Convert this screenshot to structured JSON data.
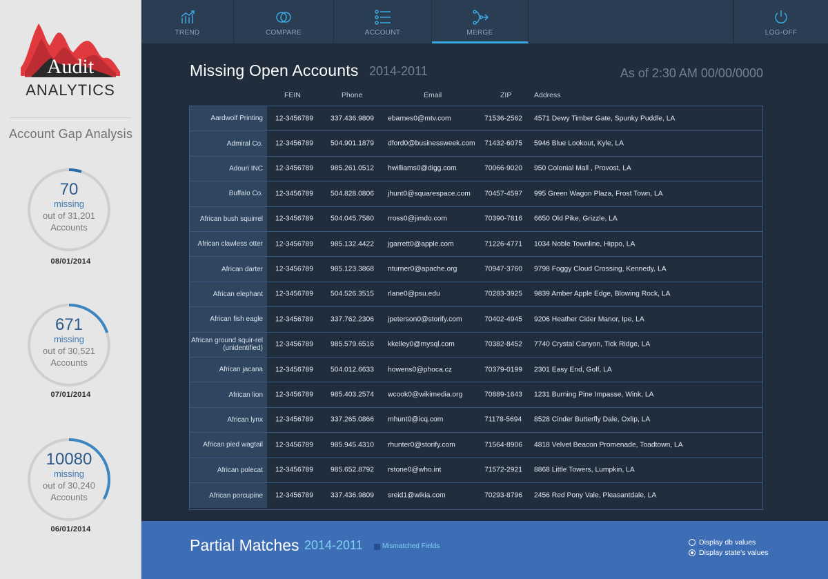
{
  "logo": {
    "line1": "Audit",
    "line2": "ANALYTICS"
  },
  "sidebar": {
    "title": "Account Gap Analysis",
    "gauges": [
      {
        "number": "70",
        "missing": "missing",
        "out_of": "out of 31,201",
        "accounts": "Accounts",
        "date": "08/01/2014",
        "fraction": 0.05
      },
      {
        "number": "671",
        "missing": "missing",
        "out_of": "out of 30,521",
        "accounts": "Accounts",
        "date": "07/01/2014",
        "fraction": 0.2
      },
      {
        "number": "10080",
        "missing": "missing",
        "out_of": "out of 30,240",
        "accounts": "Accounts",
        "date": "06/01/2014",
        "fraction": 0.33
      }
    ]
  },
  "nav": {
    "trend": "TREND",
    "compare": "COMPARE",
    "account": "ACCOUNT",
    "merge": "MERGE",
    "logoff": "LOG-OFF"
  },
  "main": {
    "title": "Missing Open Accounts",
    "years": "2014-2011",
    "as_of": "As of 2:30 AM 00/00/0000",
    "columns": {
      "fein": "FEIN",
      "phone": "Phone",
      "email": "Email",
      "zip": "ZIP",
      "address": "Address"
    },
    "rows": [
      {
        "name": "Aardwolf Printing",
        "fein": "12-3456789",
        "phone": "337.436.9809",
        "email": "ebarnes0@mtv.com",
        "zip": "71536-2562",
        "address": "4571 Dewy Timber Gate, Spunky Puddle, LA"
      },
      {
        "name": "Admiral Co.",
        "fein": "12-3456789",
        "phone": "504.901.1879",
        "email": "dford0@businessweek.com",
        "zip": "71432-6075",
        "address": "5946 Blue Lookout, Kyle, LA"
      },
      {
        "name": "Adouri INC",
        "fein": "12-3456789",
        "phone": "985.261.0512",
        "email": "hwilliams0@digg.com",
        "zip": "70066-9020",
        "address": "950 Colonial Mall , Provost, LA"
      },
      {
        "name": "Buffalo  Co.",
        "fein": "12-3456789",
        "phone": "504.828.0806",
        "email": "jhunt0@squarespace.com",
        "zip": "70457-4597",
        "address": "995 Green Wagon Plaza, Frost Town, LA"
      },
      {
        "name": "African bush squirrel",
        "fein": "12-3456789",
        "phone": "504.045.7580",
        "email": "rross0@jimdo.com",
        "zip": "70390-7816",
        "address": "6650 Old Pike, Grizzle, LA"
      },
      {
        "name": "African clawless otter",
        "fein": "12-3456789",
        "phone": "985.132.4422",
        "email": "jgarrett0@apple.com",
        "zip": "71226-4771",
        "address": "1034 Noble Townline, Hippo, LA"
      },
      {
        "name": "African darter",
        "fein": "12-3456789",
        "phone": "985.123.3868",
        "email": "nturner0@apache.org",
        "zip": "70947-3760",
        "address": "9798 Foggy Cloud Crossing, Kennedy, LA"
      },
      {
        "name": "African elephant",
        "fein": "12-3456789",
        "phone": "504.526.3515",
        "email": "rlane0@psu.edu",
        "zip": "70283-3925",
        "address": "9839 Amber Apple Edge, Blowing Rock, LA"
      },
      {
        "name": "African fish eagle",
        "fein": "12-3456789",
        "phone": "337.762.2306",
        "email": "jpeterson0@storify.com",
        "zip": "70402-4945",
        "address": "9206 Heather Cider Manor, Ipe, LA"
      },
      {
        "name": "African ground squir-rel (unidentified)",
        "fein": "12-3456789",
        "phone": "985.579.6516",
        "email": "kkelley0@mysql.com",
        "zip": "70382-8452",
        "address": "7740 Crystal Canyon, Tick Ridge, LA"
      },
      {
        "name": "African jacana",
        "fein": "12-3456789",
        "phone": "504.012.6633",
        "email": "howens0@phoca.cz",
        "zip": "70379-0199",
        "address": "2301 Easy End, Golf, LA"
      },
      {
        "name": "African lion",
        "fein": "12-3456789",
        "phone": "985.403.2574",
        "email": "wcook0@wikimedia.org",
        "zip": "70889-1643",
        "address": "1231 Burning Pine Impasse, Wink, LA"
      },
      {
        "name": "African lynx",
        "fein": "12-3456789",
        "phone": "337.265.0866",
        "email": "mhunt0@icq.com",
        "zip": "71178-5694",
        "address": "8528 Cinder Butterfly Dale, Oxlip, LA"
      },
      {
        "name": "African pied wagtail",
        "fein": "12-3456789",
        "phone": "985.945.4310",
        "email": "rhunter0@storify.com",
        "zip": "71564-8906",
        "address": "4818 Velvet Beacon Promenade, Toadtown, LA"
      },
      {
        "name": "African polecat",
        "fein": "12-3456789",
        "phone": "985.652.8792",
        "email": "rstone0@who.int",
        "zip": "71572-2921",
        "address": "8868 Little Towers, Lumpkin, LA"
      },
      {
        "name": "African porcupine",
        "fein": "12-3456789",
        "phone": "337.436.9809",
        "email": "sreid1@wikia.com",
        "zip": "70293-8796",
        "address": "2456 Red Pony Vale, Pleasantdale, LA"
      }
    ]
  },
  "partial": {
    "title": "Partial Matches",
    "years": "2014-2011",
    "legend": "Mismatched Fields",
    "option_db": "Display db values",
    "option_state": "Display state's values"
  },
  "colors": {
    "accent": "#3aa8e0",
    "logo_red": "#e0393e",
    "bottom_bar": "#3c6db5"
  }
}
